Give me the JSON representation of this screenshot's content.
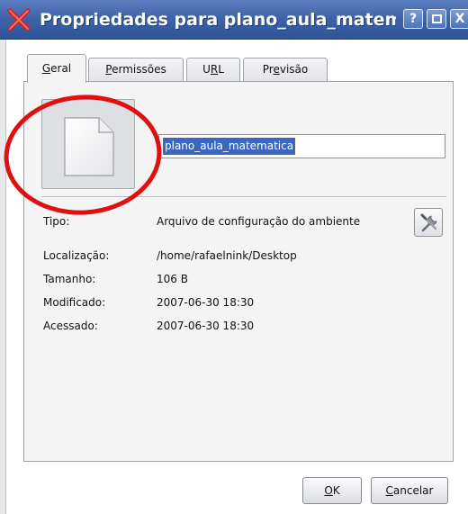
{
  "window": {
    "title": "Propriedades para plano_aula_matem",
    "help_label": "?",
    "close_label": "X"
  },
  "tabs": [
    {
      "pre": "",
      "key": "G",
      "post": "eral",
      "active": true
    },
    {
      "pre": "",
      "key": "P",
      "post": "ermissões",
      "active": false
    },
    {
      "pre": "U",
      "key": "R",
      "post": "L",
      "active": false
    },
    {
      "pre": "Pr",
      "key": "e",
      "post": "visão",
      "active": false
    }
  ],
  "general": {
    "name_value": "plano_aula_matematica",
    "icon": "text-file-icon",
    "properties": [
      {
        "label": "Tipo:",
        "value": "Arquivo de configuração do ambiente"
      },
      {
        "label": "Localização:",
        "value": "/home/rafaelnink/Desktop"
      },
      {
        "label": "Tamanho:",
        "value": "106 B"
      },
      {
        "label": "Modificado:",
        "value": "2007-06-30 18:30"
      },
      {
        "label": "Acessado:",
        "value": "2007-06-30 18:30"
      }
    ],
    "tool_button_icon": "configure-tools-icon"
  },
  "buttons": {
    "ok": {
      "key": "O",
      "post": "K"
    },
    "cancel": {
      "key": "C",
      "post": "ancelar"
    }
  },
  "colors": {
    "titlebar": "#3f64aa",
    "selection": "#3b66c4",
    "annotation": "#e01010"
  }
}
